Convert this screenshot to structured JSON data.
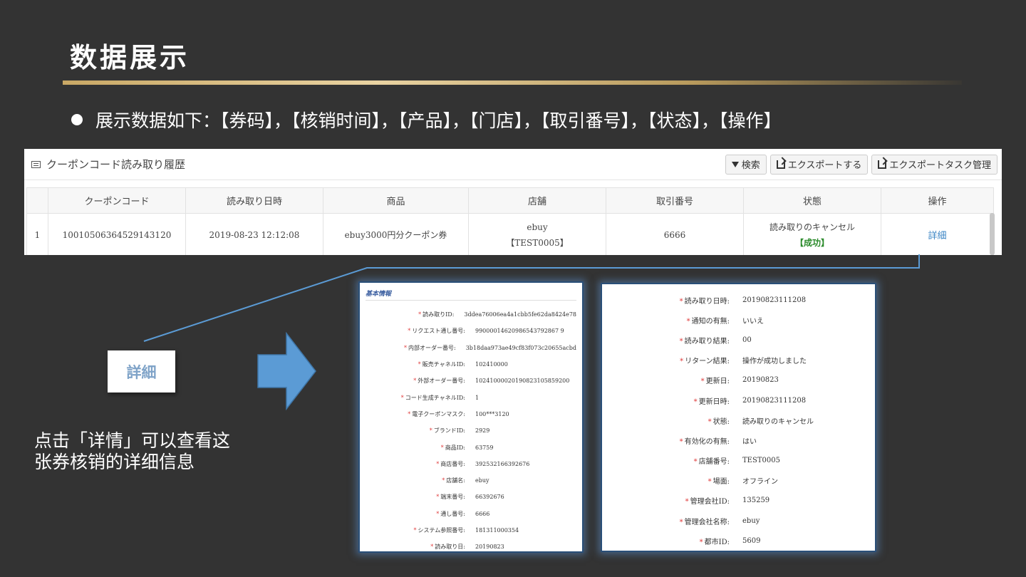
{
  "slide": {
    "title": "数据展示",
    "bullet": "展示数据如下：【券码】，【核销时间】，【产品】，【门店】，【取引番号】，【状态】，【操作】",
    "detail_label": "詳細",
    "caption_line1": "点击「详情」可以查看这",
    "caption_line2": "张券核销的详细信息"
  },
  "panel": {
    "title": "クーポンコード読み取り履歴",
    "buttons": {
      "search": "検索",
      "export": "エクスポートする",
      "export_task": "エクスポートタスク管理"
    },
    "columns": [
      "",
      "クーポンコード",
      "読み取り日時",
      "商品",
      "店舗",
      "取引番号",
      "状態",
      "操作"
    ],
    "row": {
      "index": "1",
      "coupon_code": "10010506364529143120",
      "datetime": "2019-08-23 12:12:08",
      "product": "ebuy3000円分クーポン券",
      "store_name": "ebuy",
      "store_code": "【TEST0005】",
      "transaction_no": "6666",
      "status": "読み取りのキャンセル",
      "status_result": "【成功】",
      "action": "詳細"
    }
  },
  "detail_left": {
    "section": "基本情報",
    "fields": [
      {
        "label": "読み取りID:",
        "value": "3ddea76006ea4a1cbb5fe62da8424e78"
      },
      {
        "label": "リクエスト通し番号:",
        "value": "99000014620986543792867 9"
      },
      {
        "label": "内部オーダー番号:",
        "value": "3b18daa973ae49cf83f073c20655acbd"
      },
      {
        "label": "販売チャネルID:",
        "value": "102410000"
      },
      {
        "label": "外部オーダー番号:",
        "value": "10241000020190823105859200"
      },
      {
        "label": "コード生成チャネルID:",
        "value": "1"
      },
      {
        "label": "電子クーポンマスク:",
        "value": "100***3120"
      },
      {
        "label": "ブランドID:",
        "value": "2929"
      },
      {
        "label": "商品ID:",
        "value": "63759"
      },
      {
        "label": "商店番号:",
        "value": "392532166392676"
      },
      {
        "label": "店舗名:",
        "value": "ebuy"
      },
      {
        "label": "端末番号:",
        "value": "66392676"
      },
      {
        "label": "通し番号:",
        "value": "6666"
      },
      {
        "label": "システム参照番号:",
        "value": "181311000354"
      },
      {
        "label": "読み取り日:",
        "value": "20190823"
      }
    ]
  },
  "detail_right": {
    "fields": [
      {
        "label": "読み取り日時:",
        "value": "20190823111208"
      },
      {
        "label": "通知の有無:",
        "value": "いいえ"
      },
      {
        "label": "読み取り結果:",
        "value": "00"
      },
      {
        "label": "リターン結果:",
        "value": "操作が成功しました"
      },
      {
        "label": "更新日:",
        "value": "20190823"
      },
      {
        "label": "更新日時:",
        "value": "20190823111208"
      },
      {
        "label": "状態:",
        "value": "読み取りのキャンセル"
      },
      {
        "label": "有効化の有無:",
        "value": "はい"
      },
      {
        "label": "店舗番号:",
        "value": "TEST0005"
      },
      {
        "label": "場面:",
        "value": "オフライン"
      },
      {
        "label": "管理会社ID:",
        "value": "135259"
      },
      {
        "label": "管理会社名称:",
        "value": "ebuy"
      },
      {
        "label": "都市ID:",
        "value": "5609"
      }
    ]
  },
  "colors": {
    "accent_gold": "#c9a865",
    "arrow_blue": "#5b9bd5",
    "link_blue": "#3a84c4",
    "success_green": "#2a8a2a"
  }
}
